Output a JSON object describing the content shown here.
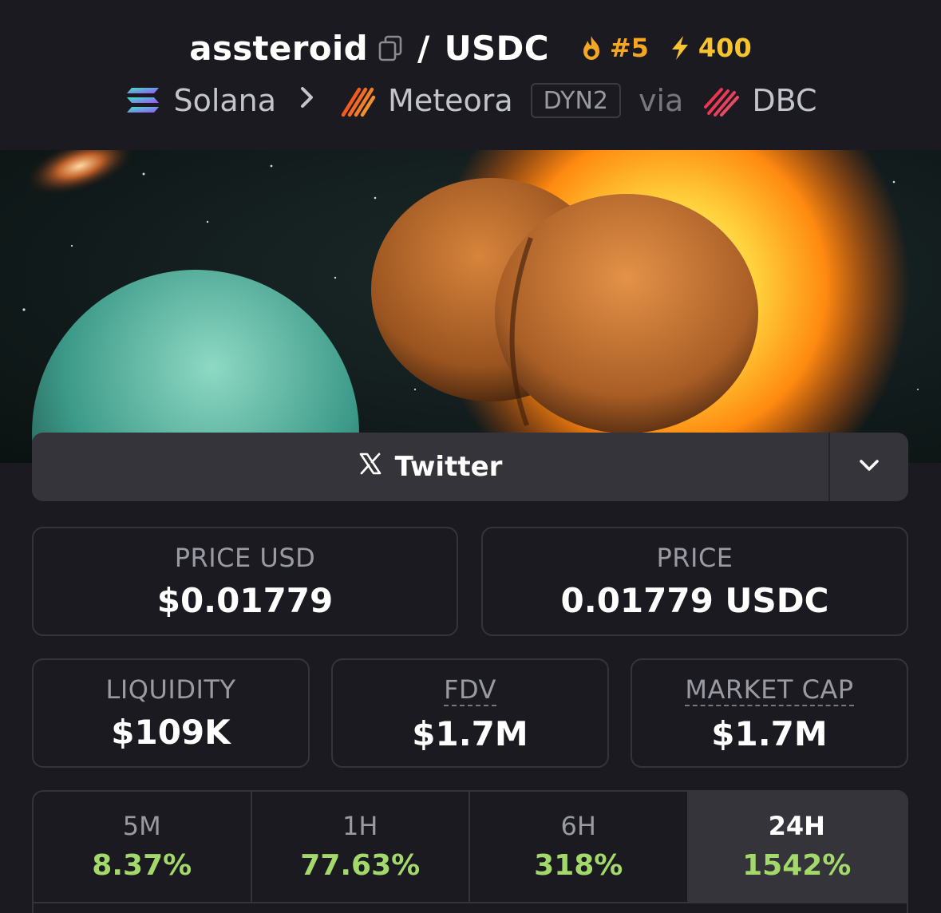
{
  "header": {
    "base_token": "assteroid",
    "separator": "/",
    "quote_token": "USDC",
    "rank": "#5",
    "boost": "400",
    "chain": "Solana",
    "dex": "Meteora",
    "pool_type": "DYN2",
    "via": "via",
    "launchpad": "DBC"
  },
  "socials": {
    "twitter_label": "Twitter"
  },
  "stats": {
    "price_usd_label": "PRICE USD",
    "price_usd_value": "$0.01779",
    "price_label": "PRICE",
    "price_value": "0.01779 USDC",
    "liquidity_label": "LIQUIDITY",
    "liquidity_value": "$109K",
    "fdv_label": "FDV",
    "fdv_value": "$1.7M",
    "mcap_label": "MARKET CAP",
    "mcap_value": "$1.7M"
  },
  "timeframes": [
    {
      "label": "5M",
      "value": "8.37%"
    },
    {
      "label": "1H",
      "value": "77.63%"
    },
    {
      "label": "6H",
      "value": "318%"
    },
    {
      "label": "24H",
      "value": "1542%",
      "active": true
    }
  ],
  "colors": {
    "background": "#1a1a20",
    "card_border": "#34343a",
    "positive": "#a3d86b",
    "rank_orange": "#f5a623",
    "boost_yellow": "#f7c32e"
  },
  "icons": {
    "copy": "copy-icon",
    "flame": "flame-icon",
    "bolt": "bolt-icon",
    "chevron_right": "chevron-right-icon",
    "x_logo": "x-logo-icon",
    "chevron_down": "chevron-down-icon"
  }
}
